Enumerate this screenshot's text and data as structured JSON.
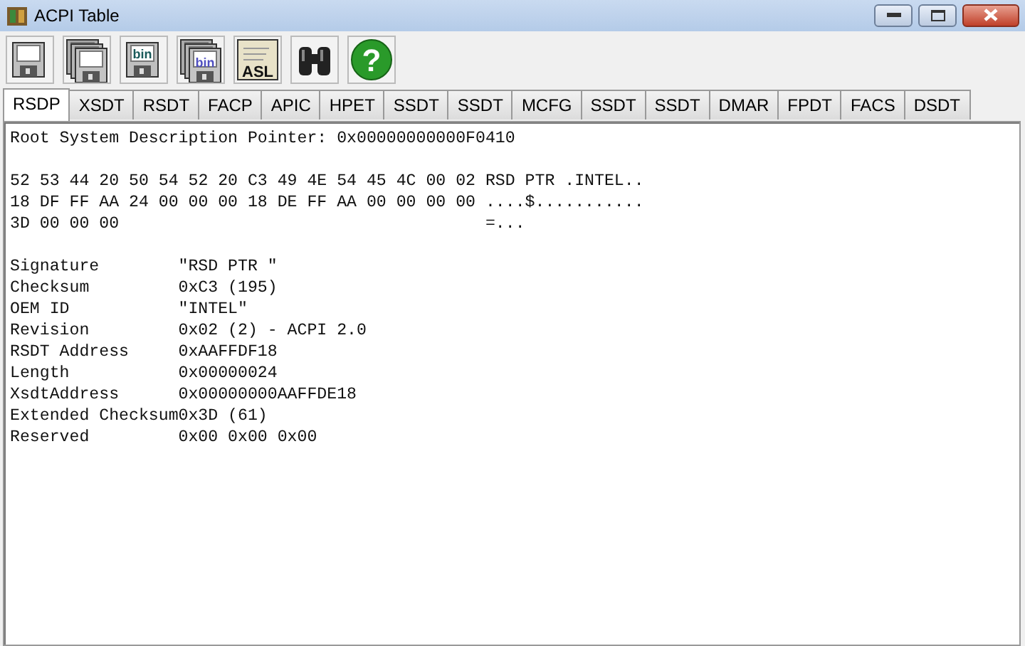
{
  "window": {
    "title": "ACPI Table"
  },
  "toolbar": [
    {
      "kind": "floppy"
    },
    {
      "kind": "floppy_stack"
    },
    {
      "kind": "floppy",
      "label": "bin"
    },
    {
      "kind": "floppy_stack",
      "label": "bin"
    },
    {
      "kind": "document",
      "label": "ASL"
    },
    {
      "kind": "binoculars"
    },
    {
      "kind": "help",
      "label": "?"
    }
  ],
  "tabs": [
    {
      "label": "RSDP",
      "selected": true
    },
    {
      "label": "XSDT",
      "selected": false
    },
    {
      "label": "RSDT",
      "selected": false
    },
    {
      "label": "FACP",
      "selected": false
    },
    {
      "label": "APIC",
      "selected": false
    },
    {
      "label": "HPET",
      "selected": false
    },
    {
      "label": "SSDT",
      "selected": false
    },
    {
      "label": "SSDT",
      "selected": false
    },
    {
      "label": "MCFG",
      "selected": false
    },
    {
      "label": "SSDT",
      "selected": false
    },
    {
      "label": "SSDT",
      "selected": false
    },
    {
      "label": "DMAR",
      "selected": false
    },
    {
      "label": "FPDT",
      "selected": false
    },
    {
      "label": "FACS",
      "selected": false
    },
    {
      "label": "DSDT",
      "selected": false
    }
  ],
  "content": {
    "heading": "Root System Description Pointer: 0x00000000000F0410",
    "hex_rows": [
      {
        "hex": "52 53 44 20 50 54 52 20 C3 49 4E 54 45 4C 00 02",
        "ascii": "RSD PTR .INTEL.."
      },
      {
        "hex": "18 DF FF AA 24 00 00 00 18 DE FF AA 00 00 00 00",
        "ascii": "....$..........."
      },
      {
        "hex": "3D 00 00 00",
        "ascii": "=..."
      }
    ],
    "fields": [
      {
        "name": "Signature",
        "value": "\"RSD PTR \""
      },
      {
        "name": "Checksum",
        "value": "0xC3 (195)"
      },
      {
        "name": "OEM ID",
        "value": "\"INTEL\""
      },
      {
        "name": "Revision",
        "value": "0x02 (2) - ACPI 2.0"
      },
      {
        "name": "RSDT Address",
        "value": "0xAAFFDF18"
      },
      {
        "name": "Length",
        "value": "0x00000024"
      },
      {
        "name": "XsdtAddress",
        "value": "0x00000000AAFFDE18"
      },
      {
        "name": "Extended Checksum",
        "value": "0x3D (61)"
      },
      {
        "name": "Reserved",
        "value": "0x00 0x00 0x00"
      }
    ]
  }
}
